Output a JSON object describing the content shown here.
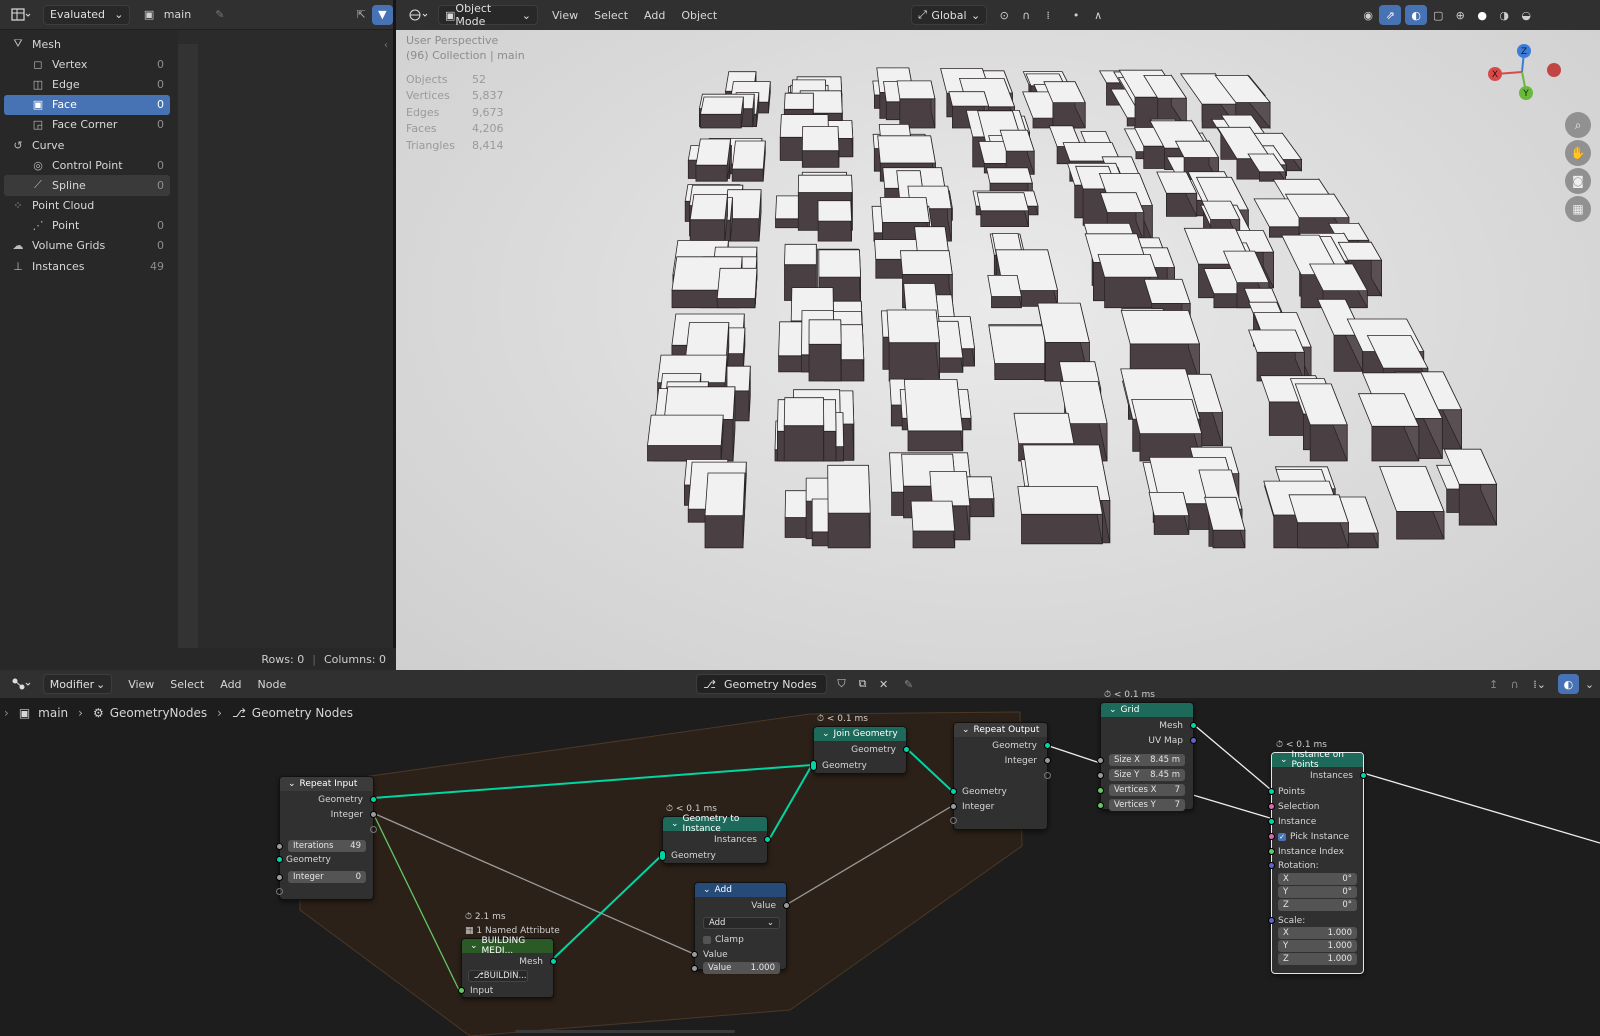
{
  "spreadsheet": {
    "display_mode": "Evaluated",
    "object_name": "main",
    "tree": [
      {
        "label": "Mesh",
        "count": "",
        "icon": "mesh-icon",
        "indent": 0
      },
      {
        "label": "Vertex",
        "count": "0",
        "icon": "vertex-icon",
        "indent": 1
      },
      {
        "label": "Edge",
        "count": "0",
        "icon": "edge-icon",
        "indent": 1
      },
      {
        "label": "Face",
        "count": "0",
        "icon": "face-icon",
        "indent": 1,
        "selected": true
      },
      {
        "label": "Face Corner",
        "count": "0",
        "icon": "face-corner-icon",
        "indent": 1
      },
      {
        "label": "Curve",
        "count": "",
        "icon": "curve-icon",
        "indent": 0
      },
      {
        "label": "Control Point",
        "count": "0",
        "icon": "control-point-icon",
        "indent": 1
      },
      {
        "label": "Spline",
        "count": "0",
        "icon": "spline-icon",
        "indent": 1,
        "highlight": true
      },
      {
        "label": "Point Cloud",
        "count": "",
        "icon": "point-cloud-icon",
        "indent": 0
      },
      {
        "label": "Point",
        "count": "0",
        "icon": "point-icon",
        "indent": 1
      },
      {
        "label": "Volume Grids",
        "count": "0",
        "icon": "volume-icon",
        "indent": 0
      },
      {
        "label": "Instances",
        "count": "49",
        "icon": "instances-icon",
        "indent": 0
      }
    ],
    "rows": "Rows: 0",
    "columns": "Columns: 0"
  },
  "viewport": {
    "mode": "Object Mode",
    "menus": [
      "View",
      "Select",
      "Add",
      "Object"
    ],
    "orientation": "Global",
    "perspective": "User Perspective",
    "collection": "(96) Collection | main",
    "stats": [
      {
        "k": "Objects",
        "v": "52"
      },
      {
        "k": "Vertices",
        "v": "5,837"
      },
      {
        "k": "Edges",
        "v": "9,673"
      },
      {
        "k": "Faces",
        "v": "4,206"
      },
      {
        "k": "Triangles",
        "v": "8,414"
      }
    ],
    "gizmo": {
      "x": "X",
      "y": "Y",
      "z": "Z"
    }
  },
  "node_editor": {
    "context": "Modifier",
    "menus": [
      "View",
      "Select",
      "Add",
      "Node"
    ],
    "tree_name": "Geometry Nodes",
    "breadcrumb": [
      "main",
      "GeometryNodes",
      "Geometry Nodes"
    ],
    "nodes": {
      "repeat_input": {
        "title": "Repeat Input",
        "out_geometry": "Geometry",
        "out_integer": "Integer",
        "iterations_label": "Iterations",
        "iterations": "49",
        "in_geometry": "Geometry",
        "integer_label": "Integer",
        "integer": "0"
      },
      "join": {
        "timer": "< 0.1 ms",
        "title": "Join Geometry",
        "out": "Geometry",
        "in": "Geometry"
      },
      "g2i": {
        "timer": "< 0.1 ms",
        "title": "Geometry to Instance",
        "out": "Instances",
        "in": "Geometry"
      },
      "add": {
        "title": "Add",
        "out": "Value",
        "op": "Add",
        "clamp": "Clamp",
        "in_value": "Value",
        "value_label": "Value",
        "value": "1.000"
      },
      "building": {
        "timer": "2.1 ms",
        "attr": "1 Named Attribute",
        "title": "BUILDING MEDI...",
        "out": "Mesh",
        "group": "BUILDIN...",
        "in": "Input"
      },
      "repeat_output": {
        "title": "Repeat Output",
        "out_geometry": "Geometry",
        "out_integer": "Integer",
        "in_geometry": "Geometry",
        "in_integer": "Integer"
      },
      "grid": {
        "timer": "< 0.1 ms",
        "title": "Grid",
        "out_mesh": "Mesh",
        "out_uv": "UV Map",
        "size_x_label": "Size X",
        "size_x": "8.45 m",
        "size_y_label": "Size Y",
        "size_y": "8.45 m",
        "vx_label": "Vertices X",
        "vx": "7",
        "vy_label": "Vertices Y",
        "vy": "7"
      },
      "iop": {
        "timer": "< 0.1 ms",
        "title": "Instance on Points",
        "out": "Instances",
        "points": "Points",
        "selection": "Selection",
        "instance": "Instance",
        "pick": "Pick Instance",
        "index": "Instance Index",
        "rotation": "Rotation:",
        "rx": "0°",
        "ry": "0°",
        "rz": "0°",
        "scale": "Scale:",
        "sx": "1.000",
        "sy": "1.000",
        "sz": "1.000"
      }
    }
  },
  "colors": {
    "accent": "#4772b3",
    "geometry_socket": "#00d6a3",
    "frame": "#3a2c1e"
  }
}
